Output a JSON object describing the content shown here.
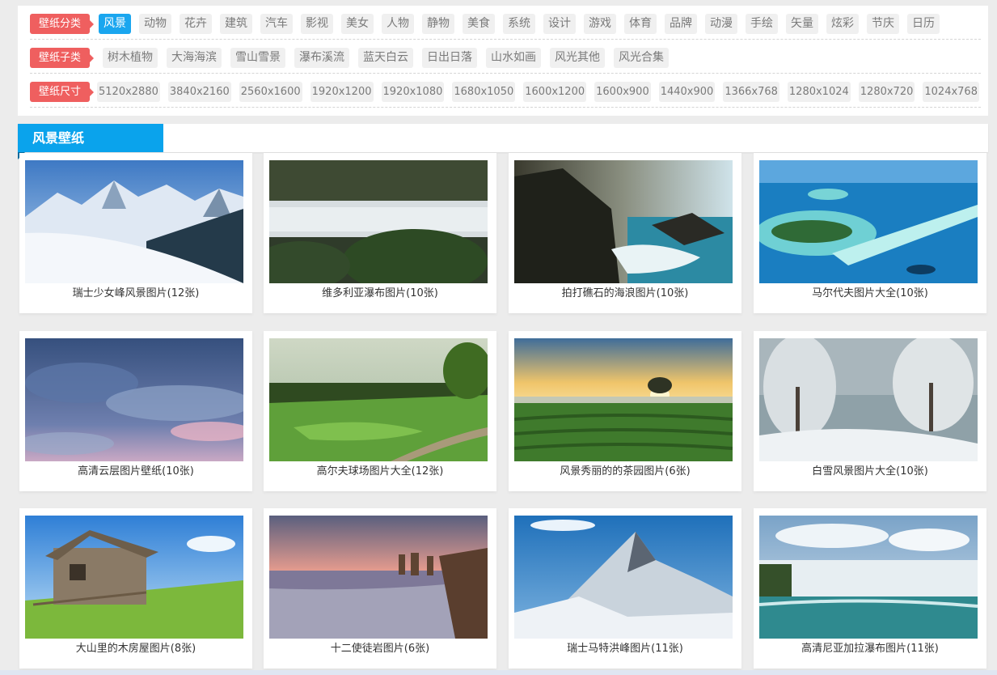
{
  "filters": {
    "category": {
      "label": "壁纸分类",
      "tags": [
        "风景",
        "动物",
        "花卉",
        "建筑",
        "汽车",
        "影视",
        "美女",
        "人物",
        "静物",
        "美食",
        "系统",
        "设计",
        "游戏",
        "体育",
        "品牌",
        "动漫",
        "手绘",
        "矢量",
        "炫彩",
        "节庆",
        "日历"
      ],
      "active": 0
    },
    "subcategory": {
      "label": "壁纸子类",
      "tags": [
        "树木植物",
        "大海海滨",
        "雪山雪景",
        "瀑布溪流",
        "蓝天白云",
        "日出日落",
        "山水如画",
        "风光其他",
        "风光合集"
      ]
    },
    "size": {
      "label": "壁纸尺寸",
      "tags": [
        "5120x2880",
        "3840x2160",
        "2560x1600",
        "1920x1200",
        "1920x1080",
        "1680x1050",
        "1600x1200",
        "1600x900",
        "1440x900",
        "1366x768",
        "1280x1024",
        "1280x720",
        "1024x768"
      ]
    }
  },
  "section": {
    "title": "风景壁纸"
  },
  "cards": [
    {
      "caption": "瑞士少女峰风景图片(12张)",
      "scene": "snow-mountain"
    },
    {
      "caption": "维多利亚瀑布图片(10张)",
      "scene": "waterfall-aerial"
    },
    {
      "caption": "拍打礁石的海浪图片(10张)",
      "scene": "rocky-coast"
    },
    {
      "caption": "马尔代夫图片大全(10张)",
      "scene": "island"
    },
    {
      "caption": "高清云层图片壁纸(10张)",
      "scene": "clouds"
    },
    {
      "caption": "高尔夫球场图片大全(12张)",
      "scene": "golf"
    },
    {
      "caption": "风景秀丽的的茶园图片(6张)",
      "scene": "tea-sunrise"
    },
    {
      "caption": "白雪风景图片大全(10张)",
      "scene": "snow-trees"
    },
    {
      "caption": "大山里的木房屋图片(8张)",
      "scene": "cabin"
    },
    {
      "caption": "十二使徒岩图片(6张)",
      "scene": "apostles"
    },
    {
      "caption": "瑞士马特洪峰图片(11张)",
      "scene": "matterhorn"
    },
    {
      "caption": "高清尼亚加拉瀑布图片(11张)",
      "scene": "niagara"
    }
  ]
}
